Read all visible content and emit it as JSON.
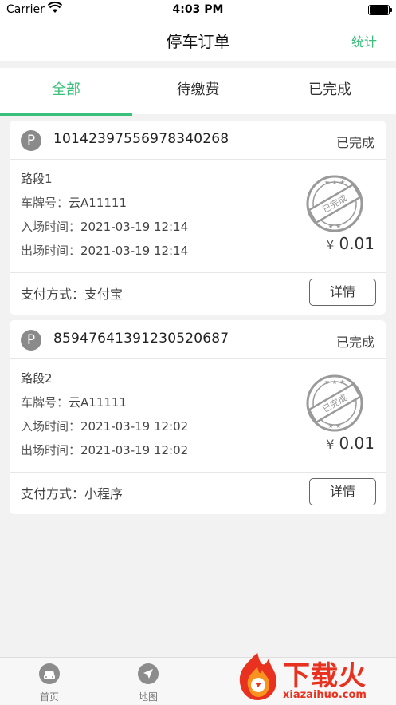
{
  "status_bar": {
    "carrier": "Carrier",
    "time": "4:03 PM"
  },
  "nav": {
    "title": "停车订单",
    "right_action": "统计"
  },
  "tabs": [
    {
      "label": "全部",
      "active": true
    },
    {
      "label": "待缴费",
      "active": false
    },
    {
      "label": "已完成",
      "active": false
    }
  ],
  "orders": [
    {
      "badge": "P",
      "order_no": "10142397556978340268",
      "status": "已完成",
      "segment": "路段1",
      "plate_label": "车牌号：",
      "plate": "云A11111",
      "entry_label": "入场时间：",
      "entry_time": "2021-03-19 12:14",
      "exit_label": "出场时间：",
      "exit_time": "2021-03-19 12:14",
      "stamp_text": "已完成",
      "currency": "¥",
      "amount": "0.01",
      "pay_label": "支付方式：",
      "pay_method": "支付宝",
      "detail_button": "详情"
    },
    {
      "badge": "P",
      "order_no": "85947641391230520687",
      "status": "已完成",
      "segment": "路段2",
      "plate_label": "车牌号：",
      "plate": "云A11111",
      "entry_label": "入场时间：",
      "entry_time": "2021-03-19 12:02",
      "exit_label": "出场时间：",
      "exit_time": "2021-03-19 12:02",
      "stamp_text": "已完成",
      "currency": "¥",
      "amount": "0.01",
      "pay_label": "支付方式：",
      "pay_method": "小程序",
      "detail_button": "详情"
    }
  ],
  "tabbar": [
    {
      "label": "首页",
      "icon": "car-icon"
    },
    {
      "label": "地图",
      "icon": "navigation-arrow-icon"
    }
  ],
  "watermark": {
    "text": "下载火",
    "subtext": "xiazaihuo.com"
  },
  "colors": {
    "accent": "#39c17c",
    "watermark": "#e8311e"
  }
}
